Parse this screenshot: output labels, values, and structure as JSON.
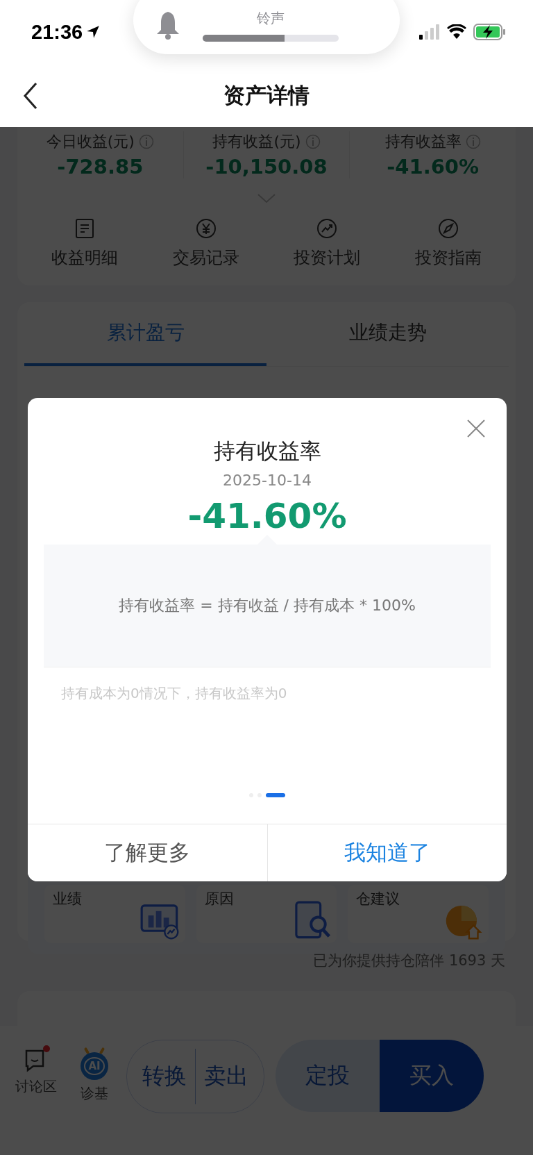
{
  "status_bar": {
    "time": "21:36"
  },
  "volume_hud": {
    "label": "铃声",
    "level": 0.6
  },
  "nav": {
    "title": "资产详情"
  },
  "stats": [
    {
      "label": "今日收益(元)",
      "value": "-728.85"
    },
    {
      "label": "持有收益(元)",
      "value": "-10,150.08"
    },
    {
      "label": "持有收益率",
      "value": "-41.60%"
    }
  ],
  "actions": [
    {
      "label": "收益明细",
      "kind": "doc"
    },
    {
      "label": "交易记录",
      "kind": "yen"
    },
    {
      "label": "投资计划",
      "kind": "trend"
    },
    {
      "label": "投资指南",
      "kind": "compass"
    }
  ],
  "tabs": [
    {
      "label": "累计盈亏",
      "selected": true
    },
    {
      "label": "业绩走势",
      "selected": false
    }
  ],
  "tiles": [
    {
      "label": "业绩",
      "kind": "chart"
    },
    {
      "label": "原因",
      "kind": "search"
    },
    {
      "label": "仓建议",
      "kind": "pie"
    }
  ],
  "footer_note": "已为你提供持仓陪伴 1693 天",
  "bottom_bar": {
    "links": [
      {
        "label": "讨论区",
        "kind": "chat",
        "badge": true
      },
      {
        "label": "诊基",
        "kind": "ai",
        "icon_text": "AI"
      }
    ],
    "trade": [
      "转换",
      "卖出"
    ],
    "plan": "定投",
    "buy": "买入"
  },
  "dialog": {
    "title": "持有收益率",
    "date": "2025-10-14",
    "value": "-41.60%",
    "formula": "持有收益率 = 持有收益 / 持有成本 * 100%",
    "note": "持有成本为0情况下，持有收益率为0",
    "pages": [
      {
        "selected": false
      },
      {
        "selected": false
      },
      {
        "selected": true
      }
    ],
    "buttons": [
      {
        "label": "了解更多",
        "primary": false
      },
      {
        "label": "我知道了",
        "primary": true
      }
    ]
  }
}
